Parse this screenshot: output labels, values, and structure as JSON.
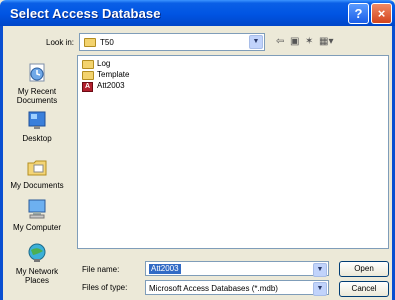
{
  "window": {
    "title": "Select Access Database",
    "help_label": "?",
    "close_label": "×"
  },
  "lookin": {
    "label": "Look in:",
    "value": "T50"
  },
  "toolbar": {
    "back": "⇦",
    "up": "▣",
    "new_folder": "✶",
    "views": "▦▾"
  },
  "places": [
    {
      "label": "My Recent Documents",
      "icon": "recent-documents-icon"
    },
    {
      "label": "Desktop",
      "icon": "desktop-icon"
    },
    {
      "label": "My Documents",
      "icon": "my-documents-icon"
    },
    {
      "label": "My Computer",
      "icon": "my-computer-icon"
    },
    {
      "label": "My Network Places",
      "icon": "network-places-icon"
    }
  ],
  "files": [
    {
      "name": "Log",
      "type": "folder"
    },
    {
      "name": "Template",
      "type": "folder"
    },
    {
      "name": "Att2003",
      "type": "access-database"
    }
  ],
  "form": {
    "file_name_label": "File name:",
    "file_name_value": "Att2003",
    "file_type_label": "Files of type:",
    "file_type_value": "Microsoft Access Databases (*.mdb)"
  },
  "buttons": {
    "open": "Open",
    "cancel": "Cancel"
  },
  "colors": {
    "titlebar": "#0054e3",
    "face": "#ece9d8",
    "selection": "#316ac5"
  }
}
